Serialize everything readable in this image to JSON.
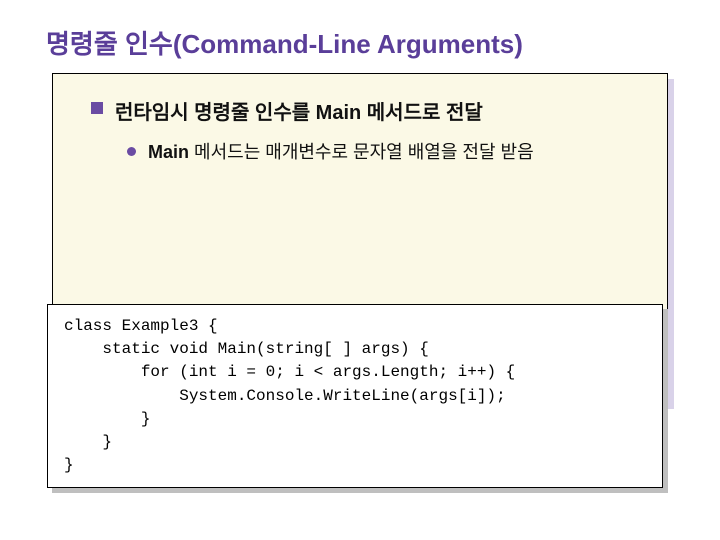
{
  "title": "명령줄 인수(Command-Line Arguments)",
  "bullet1": "런타임시 명령줄 인수를 Main 메서드로 전달",
  "bullet2_bold": "Main",
  "bullet2_rest": " 메서드는 매개변수로 문자열 배열을 전달 받음",
  "code": "class Example3 {\n    static void Main(string[ ] args) {\n        for (int i = 0; i < args.Length; i++) {\n            System.Console.WriteLine(args[i]);\n        }\n    }\n}"
}
